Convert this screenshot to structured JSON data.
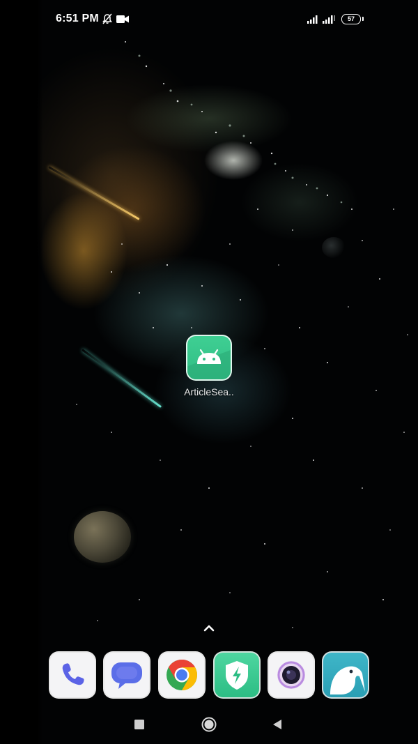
{
  "status_bar": {
    "time": "6:51 PM",
    "battery_level": "57",
    "icons": [
      "mute-notifications-icon",
      "video-recording-icon",
      "signal-icon",
      "signal-icon",
      "battery-icon"
    ]
  },
  "home": {
    "apps": [
      {
        "label": "ArticleSea..",
        "icon": "android-icon",
        "color": "#35c78a"
      }
    ]
  },
  "dock": {
    "apps": [
      {
        "icon": "phone-icon"
      },
      {
        "icon": "messages-icon"
      },
      {
        "icon": "chrome-icon"
      },
      {
        "icon": "security-icon"
      },
      {
        "icon": "camera-icon"
      },
      {
        "icon": "kiwi-browser-icon"
      }
    ]
  },
  "nav_bar": {
    "buttons": [
      "recents-button",
      "home-button",
      "back-button"
    ]
  }
}
